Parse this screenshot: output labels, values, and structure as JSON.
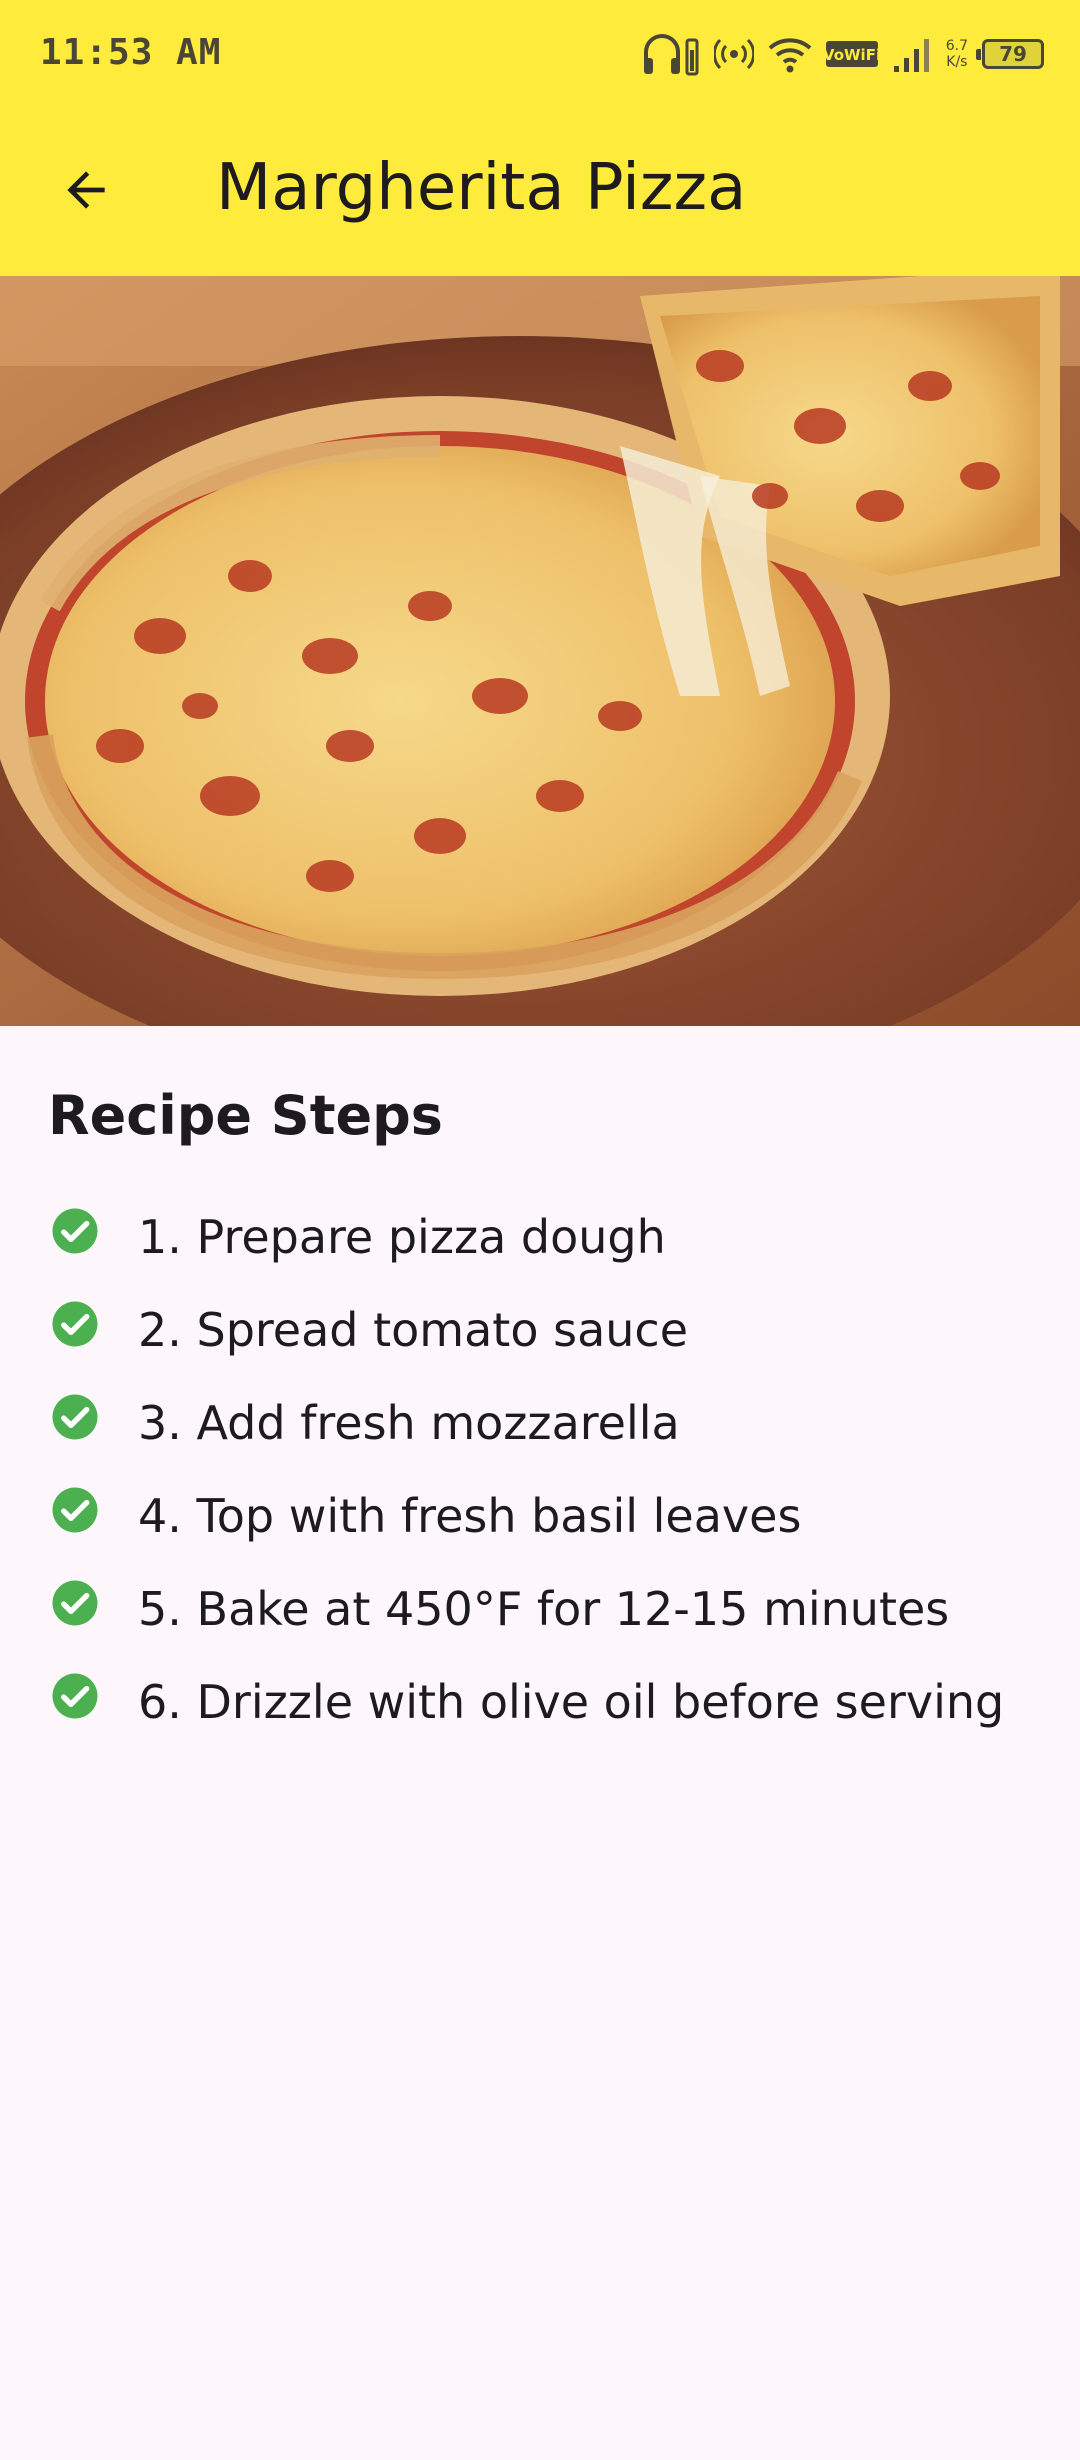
{
  "status_bar": {
    "time": "11:53 AM",
    "network_speed_value": "6.7",
    "network_speed_unit": "K/s",
    "battery_level": "79",
    "vowifi_label": "VoWiFi",
    "icons": [
      "headphones-battery-icon",
      "hotspot-icon",
      "wifi-icon",
      "vowifi-icon",
      "cell-signal-icon",
      "battery-icon"
    ]
  },
  "toolbar": {
    "back_icon": "arrow-back-icon",
    "title": "Margherita Pizza",
    "background_color": "#ffeb3b"
  },
  "hero_image": {
    "subject": "pizza-photo"
  },
  "recipe": {
    "section_title": "Recipe Steps",
    "check_icon": "check-circle-icon",
    "check_color": "#4caf50",
    "steps": [
      "1. Prepare pizza dough",
      "2. Spread tomato sauce",
      "3. Add fresh mozzarella",
      "4. Top with fresh basil leaves",
      "5. Bake at 450°F for 12-15 minutes",
      "6. Drizzle with olive oil before serving"
    ]
  }
}
